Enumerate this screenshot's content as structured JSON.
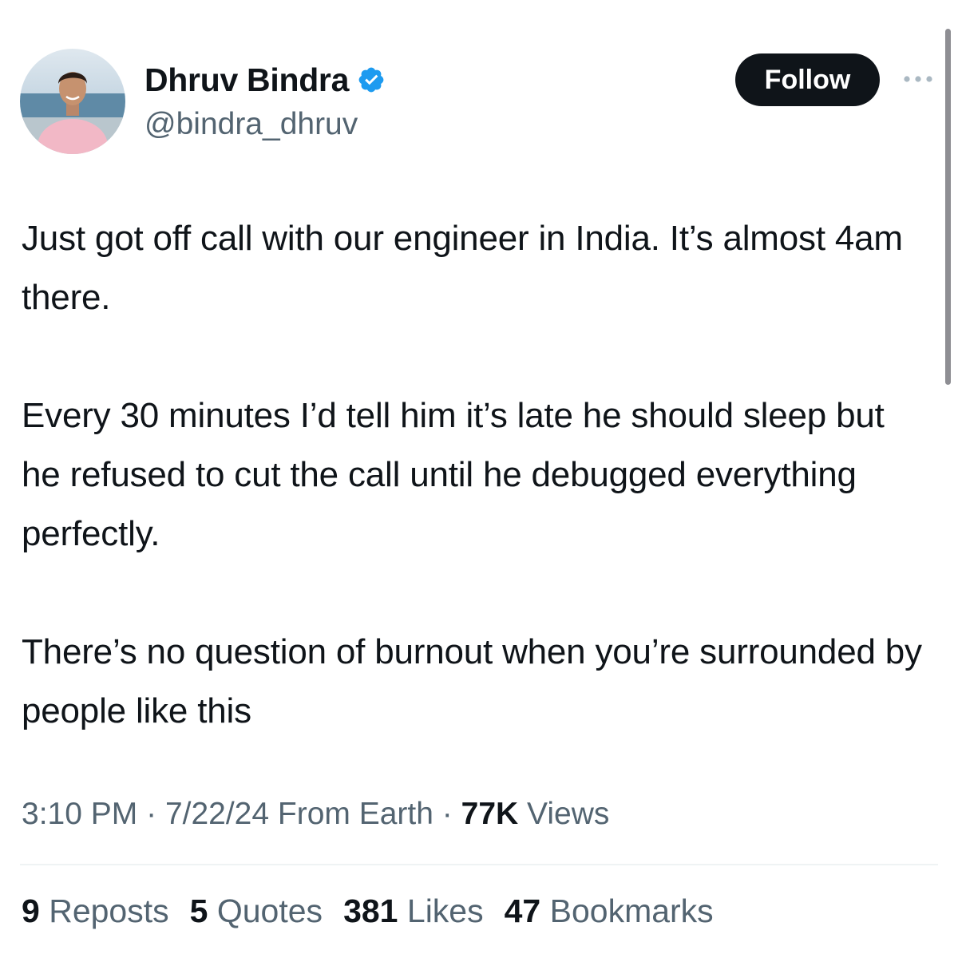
{
  "author": {
    "display_name": "Dhruv Bindra",
    "handle": "@bindra_dhruv",
    "verified": true,
    "verified_color": "#1d9bf0"
  },
  "actions": {
    "follow_label": "Follow",
    "more_icon": "more-horizontal-icon"
  },
  "tweet": {
    "paragraphs": [
      "Just got off call with our engineer in India. It’s almost 4am there.",
      "Every 30 minutes I’d tell him it’s late he should sleep but he refused to cut the call until he debugged everything perfectly.",
      "There’s no question of burnout when you’re surrounded by people like this"
    ]
  },
  "meta": {
    "time": "3:10 PM",
    "separator": "·",
    "date": "7/22/24",
    "source": "From Earth",
    "views_count": "77K",
    "views_label": "Views"
  },
  "stats": {
    "reposts_count": "9",
    "reposts_label": "Reposts",
    "quotes_count": "5",
    "quotes_label": "Quotes",
    "likes_count": "381",
    "likes_label": "Likes",
    "bookmarks_count": "47",
    "bookmarks_label": "Bookmarks"
  },
  "colors": {
    "text_primary": "#0f1419",
    "text_secondary": "#536471",
    "follow_bg": "#0f1419",
    "divider": "#eff3f4"
  }
}
